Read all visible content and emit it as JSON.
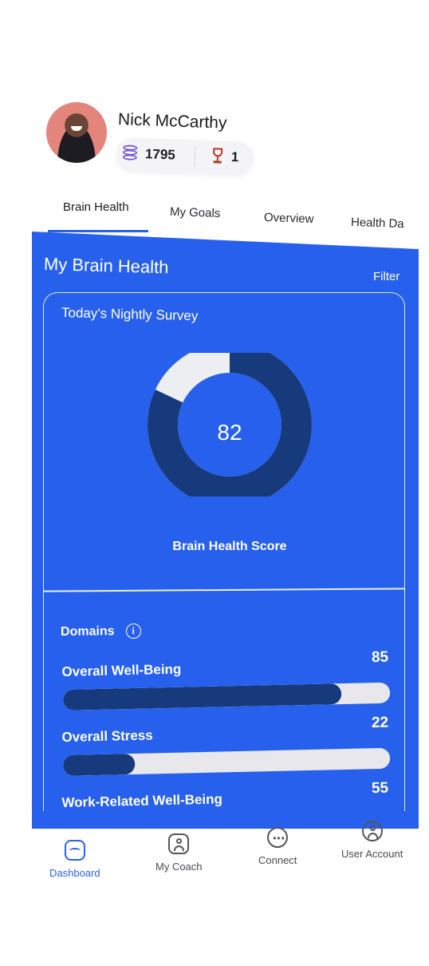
{
  "profile": {
    "name": "Nick McCarthy",
    "coins": "1795",
    "trophies": "1"
  },
  "tabs": [
    {
      "label": "Brain Health",
      "active": true
    },
    {
      "label": "My Goals",
      "active": false
    },
    {
      "label": "Overview",
      "active": false
    },
    {
      "label": "Health Da",
      "active": false
    }
  ],
  "panel": {
    "title": "My Brain Health",
    "filter_label": "Filter"
  },
  "survey": {
    "title": "Today's Nightly Survey",
    "score": "82",
    "score_fraction": 0.82,
    "score_label": "Brain Health Score"
  },
  "domains": {
    "title": "Domains",
    "info_icon": "i",
    "items": [
      {
        "name": "Overall Well-Being",
        "value": "85",
        "fraction": 0.85
      },
      {
        "name": "Overall Stress",
        "value": "22",
        "fraction": 0.22
      },
      {
        "name": "Work-Related Well-Being",
        "value": "55",
        "fraction": 0.55
      }
    ]
  },
  "nav": [
    {
      "label": "Dashboard",
      "icon": "dashboard-icon",
      "active": true
    },
    {
      "label": "My Coach",
      "icon": "coach-icon",
      "active": false
    },
    {
      "label": "Connect",
      "icon": "chat-icon",
      "active": false
    },
    {
      "label": "User Account",
      "icon": "user-account-icon",
      "active": false
    }
  ],
  "colors": {
    "panel": "#2760ec",
    "accent": "#2a62ea",
    "donut_fill": "#173a7c",
    "donut_rest": "#eceef2",
    "bar_fill": "#173a7c",
    "bar_track": "#e8e8ec"
  }
}
